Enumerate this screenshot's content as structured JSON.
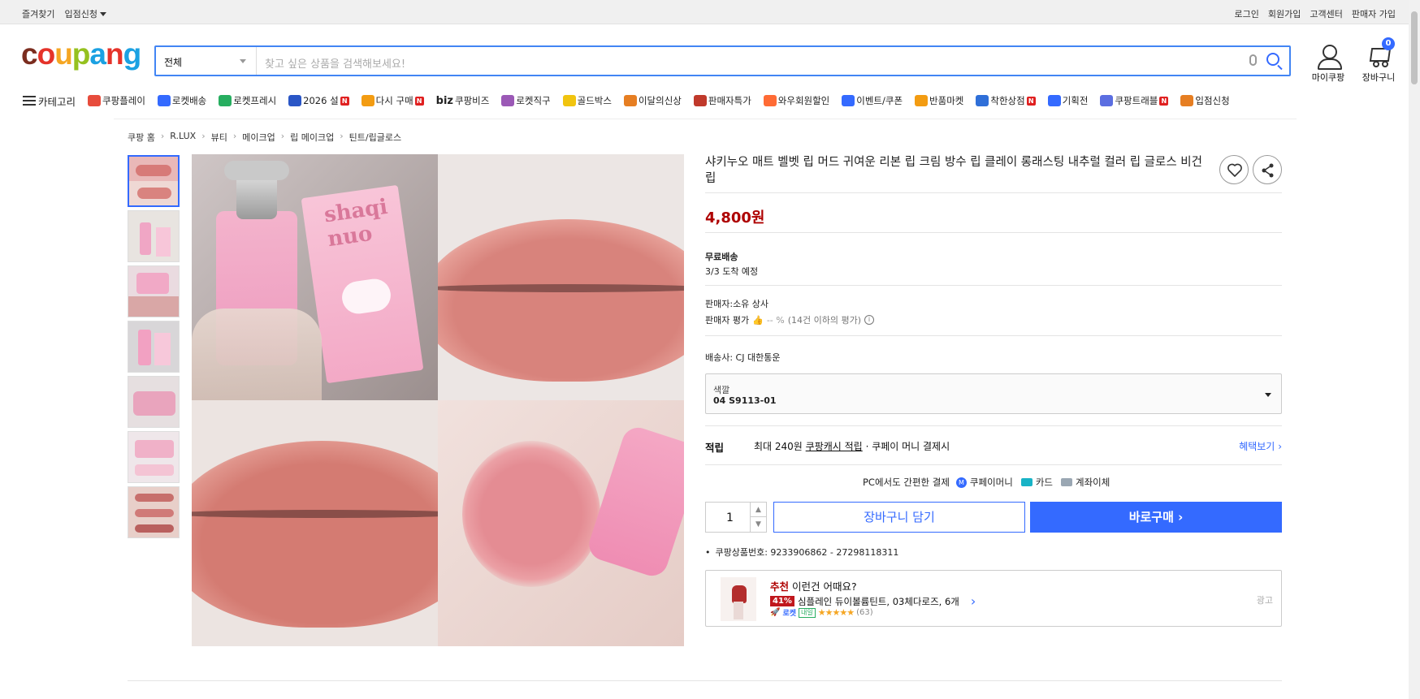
{
  "topbar": {
    "left": [
      "즐겨찾기",
      "입점신청"
    ],
    "right": [
      "로그인",
      "회원가입",
      "고객센터",
      "판매자 가입"
    ]
  },
  "logo": {
    "text": "coupang"
  },
  "search": {
    "category": "전체",
    "placeholder": "찾고 싶은 상품을 검색해보세요!"
  },
  "header": {
    "my_coupang": "마이쿠팡",
    "cart": "장바구니",
    "cart_count": "0"
  },
  "nav": {
    "category": "카테고리",
    "items": [
      {
        "label": "쿠팡플레이",
        "color": "#e74c3c",
        "new": false
      },
      {
        "label": "로켓배송",
        "color": "#346aff",
        "new": false
      },
      {
        "label": "로켓프레시",
        "color": "#27ae60",
        "new": false
      },
      {
        "label": "2026 설",
        "color": "#2a56c6",
        "new": true
      },
      {
        "label": "다시 구매",
        "color": "#f39c12",
        "new": true
      },
      {
        "label": "쿠팡비즈",
        "color": "#222222",
        "new": false,
        "prefix": "biz"
      },
      {
        "label": "로켓직구",
        "color": "#9b59b6",
        "new": false
      },
      {
        "label": "골드박스",
        "color": "#f1c40f",
        "new": false
      },
      {
        "label": "이달의신상",
        "color": "#e67e22",
        "new": false
      },
      {
        "label": "판매자특가",
        "color": "#c0392b",
        "new": false
      },
      {
        "label": "와우회원할인",
        "color": "#ff6b35",
        "new": false
      },
      {
        "label": "이벤트/쿠폰",
        "color": "#346aff",
        "new": false
      },
      {
        "label": "반품마켓",
        "color": "#f39c12",
        "new": false
      },
      {
        "label": "착한상점",
        "color": "#2f6fd8",
        "new": true
      },
      {
        "label": "기획전",
        "color": "#346aff",
        "new": false
      },
      {
        "label": "쿠팡트래블",
        "color": "#5b6ee1",
        "new": true
      },
      {
        "label": "입점신청",
        "color": "#e67e22",
        "new": false
      }
    ]
  },
  "breadcrumb": [
    "쿠팡 홈",
    "R.LUX",
    "뷰티",
    "메이크업",
    "립 메이크업",
    "틴트/립글로스"
  ],
  "product": {
    "title": "샤키누오 매트 벨벳 립 머드 귀여운 리본 립 크림 방수 립 클레이 롱래스팅 내추럴 컬러 립 글로스 비건 립",
    "price": "4,800원",
    "shipping_label": "무료배송",
    "arrival": "3/3 도착 예정",
    "seller": "판매자:소유 상사",
    "seller_rating_label": "판매자 평가",
    "seller_rating_value": "-- %",
    "seller_rating_note": "(14건 이하의 평가)",
    "carrier": "배송사:  CJ 대한통운",
    "option_label": "색깔",
    "option_value": "04 S9113-01",
    "reward_label": "적립",
    "reward_text_prefix": "최대 240원",
    "reward_text_link": "쿠팡캐시 적립",
    "reward_text_suffix": "· 쿠페이 머니 결제시",
    "benefit_link": "혜택보기",
    "pay_intro": "PC에서도 간편한 결제",
    "pay_methods": [
      "쿠페이머니",
      "카드",
      "계좌이체"
    ],
    "quantity": "1",
    "add_to_cart": "장바구니 담기",
    "buy_now": "바로구매",
    "product_id": "쿠팡상품번호: 9233906862 - 27298118311"
  },
  "recommend": {
    "tag": "추천",
    "headline": "이런건 어때요?",
    "discount": "41%",
    "item_name": "심플레인 듀이볼륨틴트, 03체다로즈, 6개",
    "rocket": "로켓",
    "naeil": "내일",
    "rating": 4.5,
    "reviews": "(63)",
    "ad": "광고"
  },
  "colors": {
    "accent": "#346aff",
    "price": "#ae0000"
  }
}
